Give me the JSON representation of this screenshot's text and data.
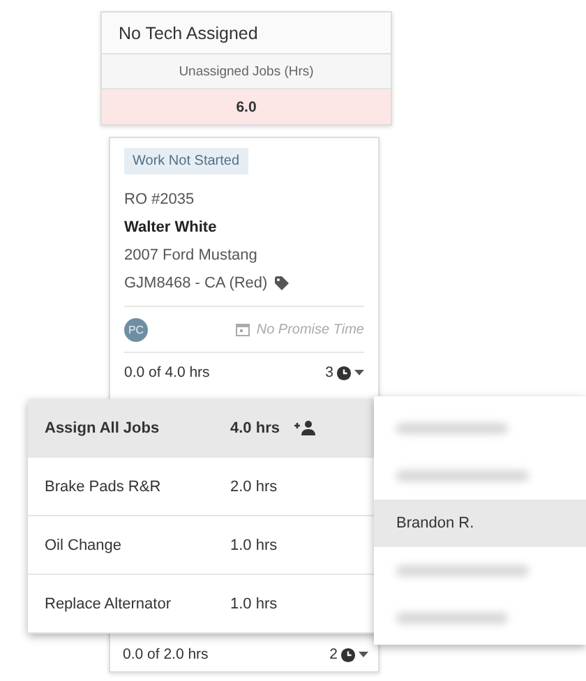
{
  "tech_column": {
    "title": "No Tech Assigned",
    "summary_label": "Unassigned Jobs (Hrs)",
    "summary_value": "6.0"
  },
  "card": {
    "status": "Work Not Started",
    "ro": "RO #2035",
    "customer": "Walter White",
    "vehicle": "2007 Ford Mustang",
    "plate": "GJM8468 - CA (Red)",
    "avatar": "PC",
    "promise": "No Promise Time",
    "hours": "0.0 of 4.0 hrs",
    "job_count": "3"
  },
  "jobs_menu": [
    {
      "label": "Assign All Jobs",
      "hours": "4.0 hrs",
      "kind": "assign_all",
      "selected": true
    },
    {
      "label": "Brake Pads R&R",
      "hours": "2.0 hrs",
      "kind": "job",
      "selected": false
    },
    {
      "label": "Oil Change",
      "hours": "1.0 hrs",
      "kind": "job",
      "selected": false
    },
    {
      "label": "Replace Alternator",
      "hours": "1.0 hrs",
      "kind": "job",
      "selected": false
    }
  ],
  "tech_menu": [
    {
      "kind": "blurred",
      "selected": false
    },
    {
      "kind": "blurred",
      "selected": false
    },
    {
      "kind": "name",
      "name": "Brandon R.",
      "selected": true
    },
    {
      "kind": "blurred",
      "selected": false
    },
    {
      "kind": "blurred",
      "selected": false
    }
  ],
  "next_card": {
    "hours": "0.0 of 2.0 hrs",
    "job_count": "2"
  }
}
